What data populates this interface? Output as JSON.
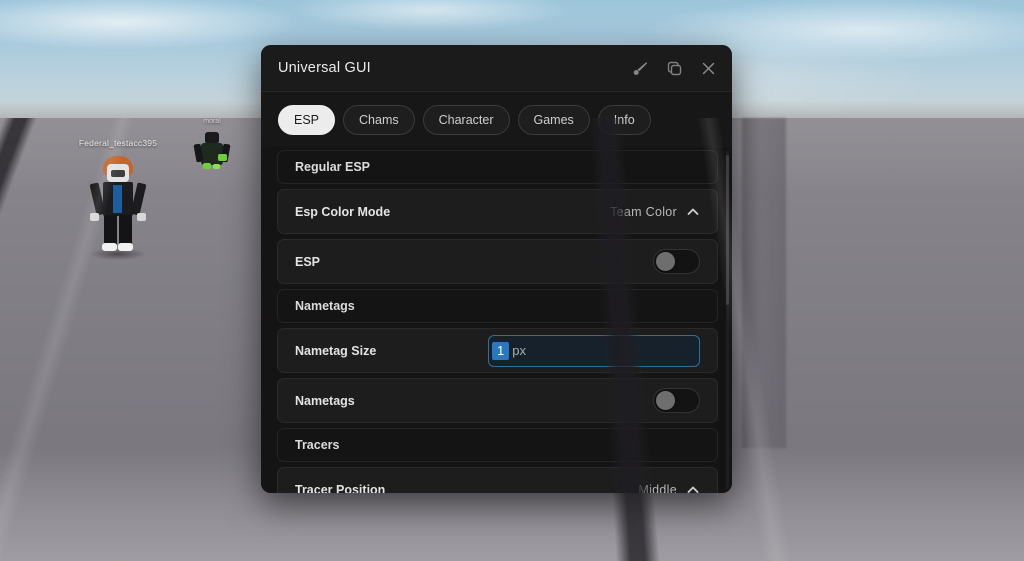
{
  "window": {
    "title": "Universal GUI",
    "actions": [
      {
        "name": "brush-icon",
        "label": "Theme"
      },
      {
        "name": "copy-icon",
        "label": "Duplicate"
      },
      {
        "name": "close-icon",
        "label": "Close"
      }
    ]
  },
  "tabs": [
    {
      "label": "ESP",
      "active": true
    },
    {
      "label": "Chams",
      "active": false
    },
    {
      "label": "Character",
      "active": false
    },
    {
      "label": "Games",
      "active": false
    },
    {
      "label": "Info",
      "active": false
    }
  ],
  "rows": [
    {
      "type": "section",
      "label": "Regular ESP"
    },
    {
      "type": "dropdown",
      "label": "Esp Color Mode",
      "value": "Team Color",
      "chevron": "chevron-up-icon"
    },
    {
      "type": "toggle",
      "label": "ESP",
      "on": false
    },
    {
      "type": "section",
      "label": "Nametags"
    },
    {
      "type": "input",
      "label": "Nametag Size",
      "selected_text": "1",
      "rest_text": "px"
    },
    {
      "type": "toggle",
      "label": "Nametags",
      "on": false
    },
    {
      "type": "section",
      "label": "Tracers"
    },
    {
      "type": "dropdown",
      "label": "Tracer Position",
      "value": "Middle",
      "chevron": "chevron-up-icon"
    }
  ],
  "scene": {
    "players": [
      {
        "nametag": "Federal_testacc395"
      },
      {
        "nametag": "moral"
      }
    ]
  },
  "colors": {
    "window_bg": "#141414",
    "titlebar_bg": "#1b1b1b",
    "row_bg": "#1d1d1d",
    "active_tab_bg": "#ececec",
    "input_border": "#2f6f9e",
    "selection_blue": "#2878c0",
    "sky": "#a8cadd",
    "floor": "#807d85"
  }
}
